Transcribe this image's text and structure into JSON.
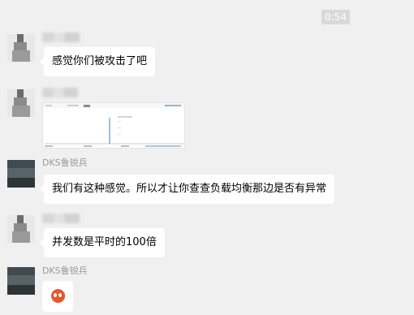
{
  "chat": {
    "timestamp": "0:54",
    "messages": [
      {
        "sender": "",
        "text": "感觉你们被攻击了吧"
      },
      {
        "sender": "",
        "text": ""
      },
      {
        "sender": "DKS鲁锐兵",
        "text": "我们有这种感觉。所以才让你查查负载均衡那边是否有异常"
      },
      {
        "sender": "",
        "text": "并发数是平时的100倍"
      },
      {
        "sender": "DKS鲁锐兵",
        "text": ""
      }
    ]
  },
  "icons": {
    "emoji": "angry-face-emoji-icon"
  },
  "colors": {
    "background": "#f0f0f0",
    "bubble": "#ffffff",
    "emoji": "#e8572a"
  }
}
